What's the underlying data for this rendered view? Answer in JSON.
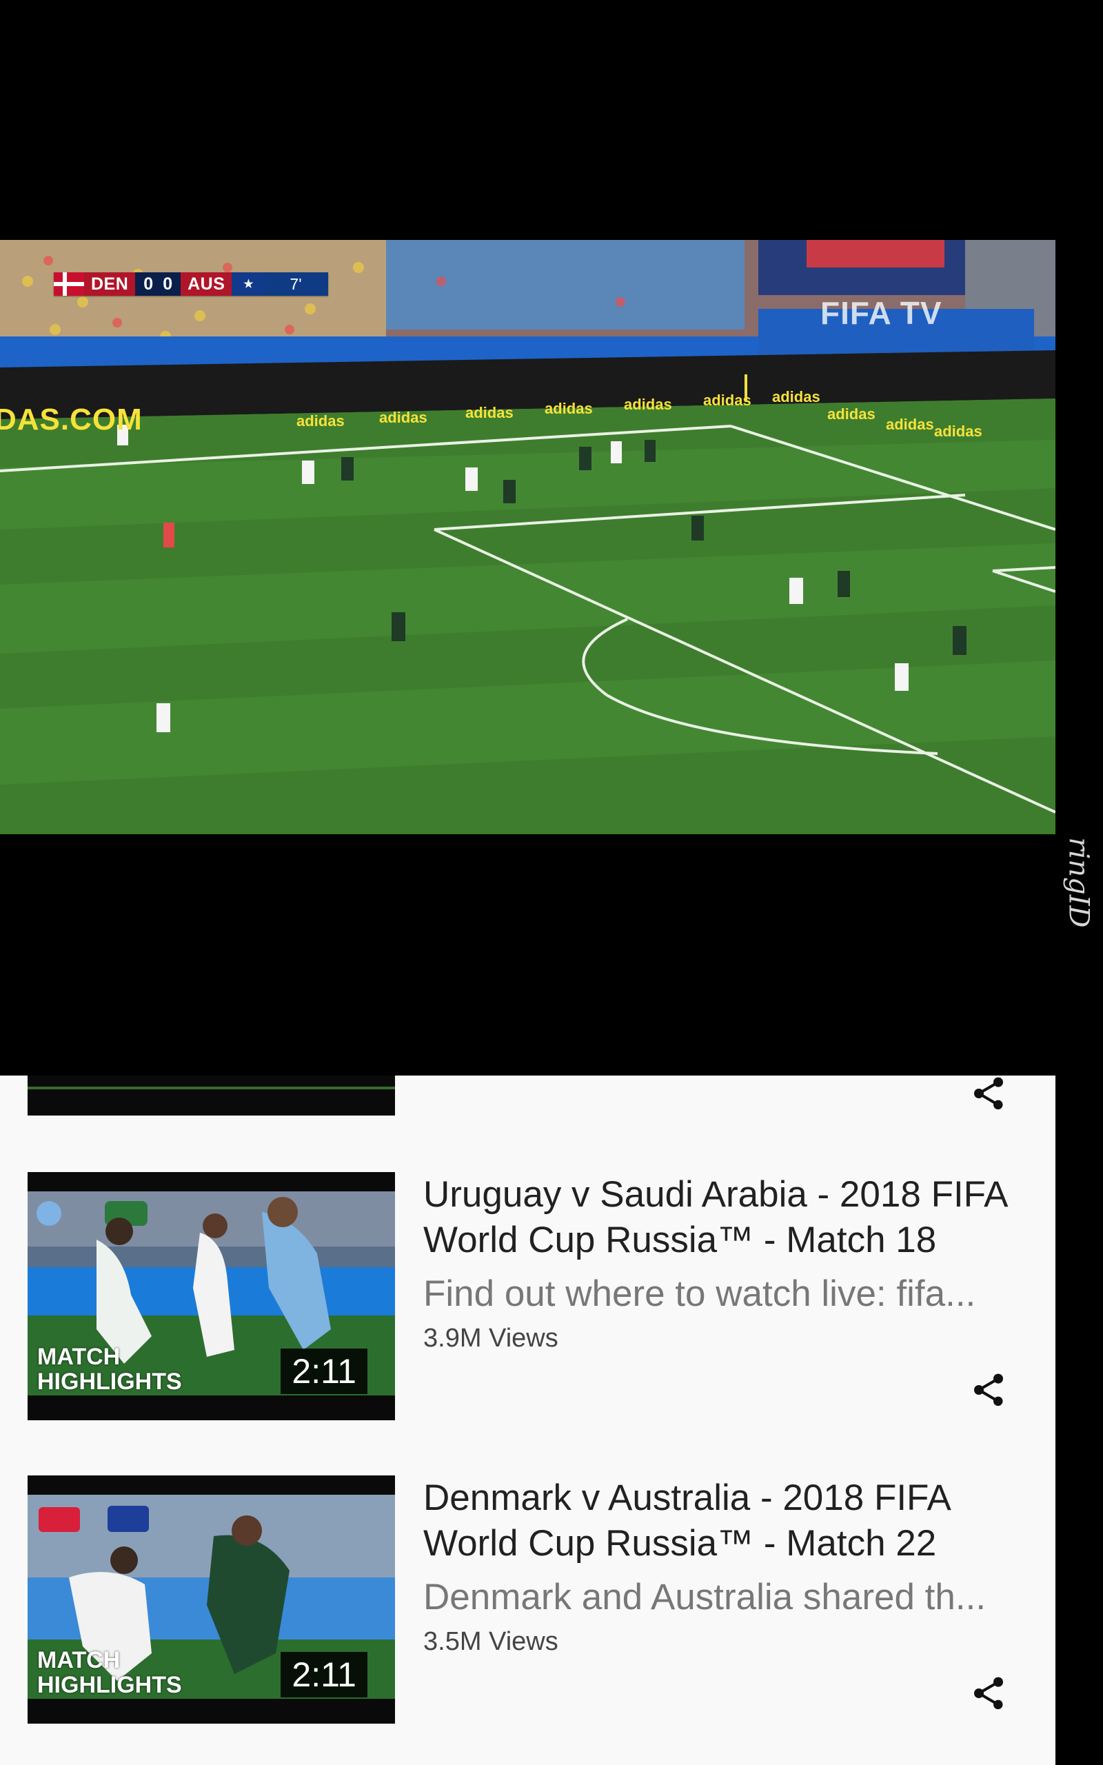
{
  "player": {
    "scorebug": {
      "home": "DEN",
      "home_score": "0",
      "away_score": "0",
      "away": "AUS",
      "clock": "7'"
    },
    "broadcast_logo": "FIFA TV",
    "board_text": "DAS.COM",
    "sponsor_text": "adidas"
  },
  "watermark": "ringID",
  "videos": [
    {
      "title": "Uruguay v Saudi Arabia - 2018 FIFA World Cup Russia™ - Match 18",
      "description": "Find out where to watch live: fifa...",
      "views": "3.9M Views",
      "duration": "2:11",
      "badge": "MATCH HIGHLIGHTS",
      "icon": "share-icon"
    },
    {
      "title": "Denmark v Australia - 2018 FIFA World Cup Russia™ - Match 22",
      "description": "Denmark and Australia shared th...",
      "views": "3.5M Views",
      "duration": "2:11",
      "badge": "MATCH HIGHLIGHTS",
      "icon": "share-icon"
    }
  ],
  "colors": {
    "list_background": "#f9f9f9",
    "title_text": "#212121",
    "description_text": "#777777",
    "pitch_green": "#3d7a2c"
  }
}
